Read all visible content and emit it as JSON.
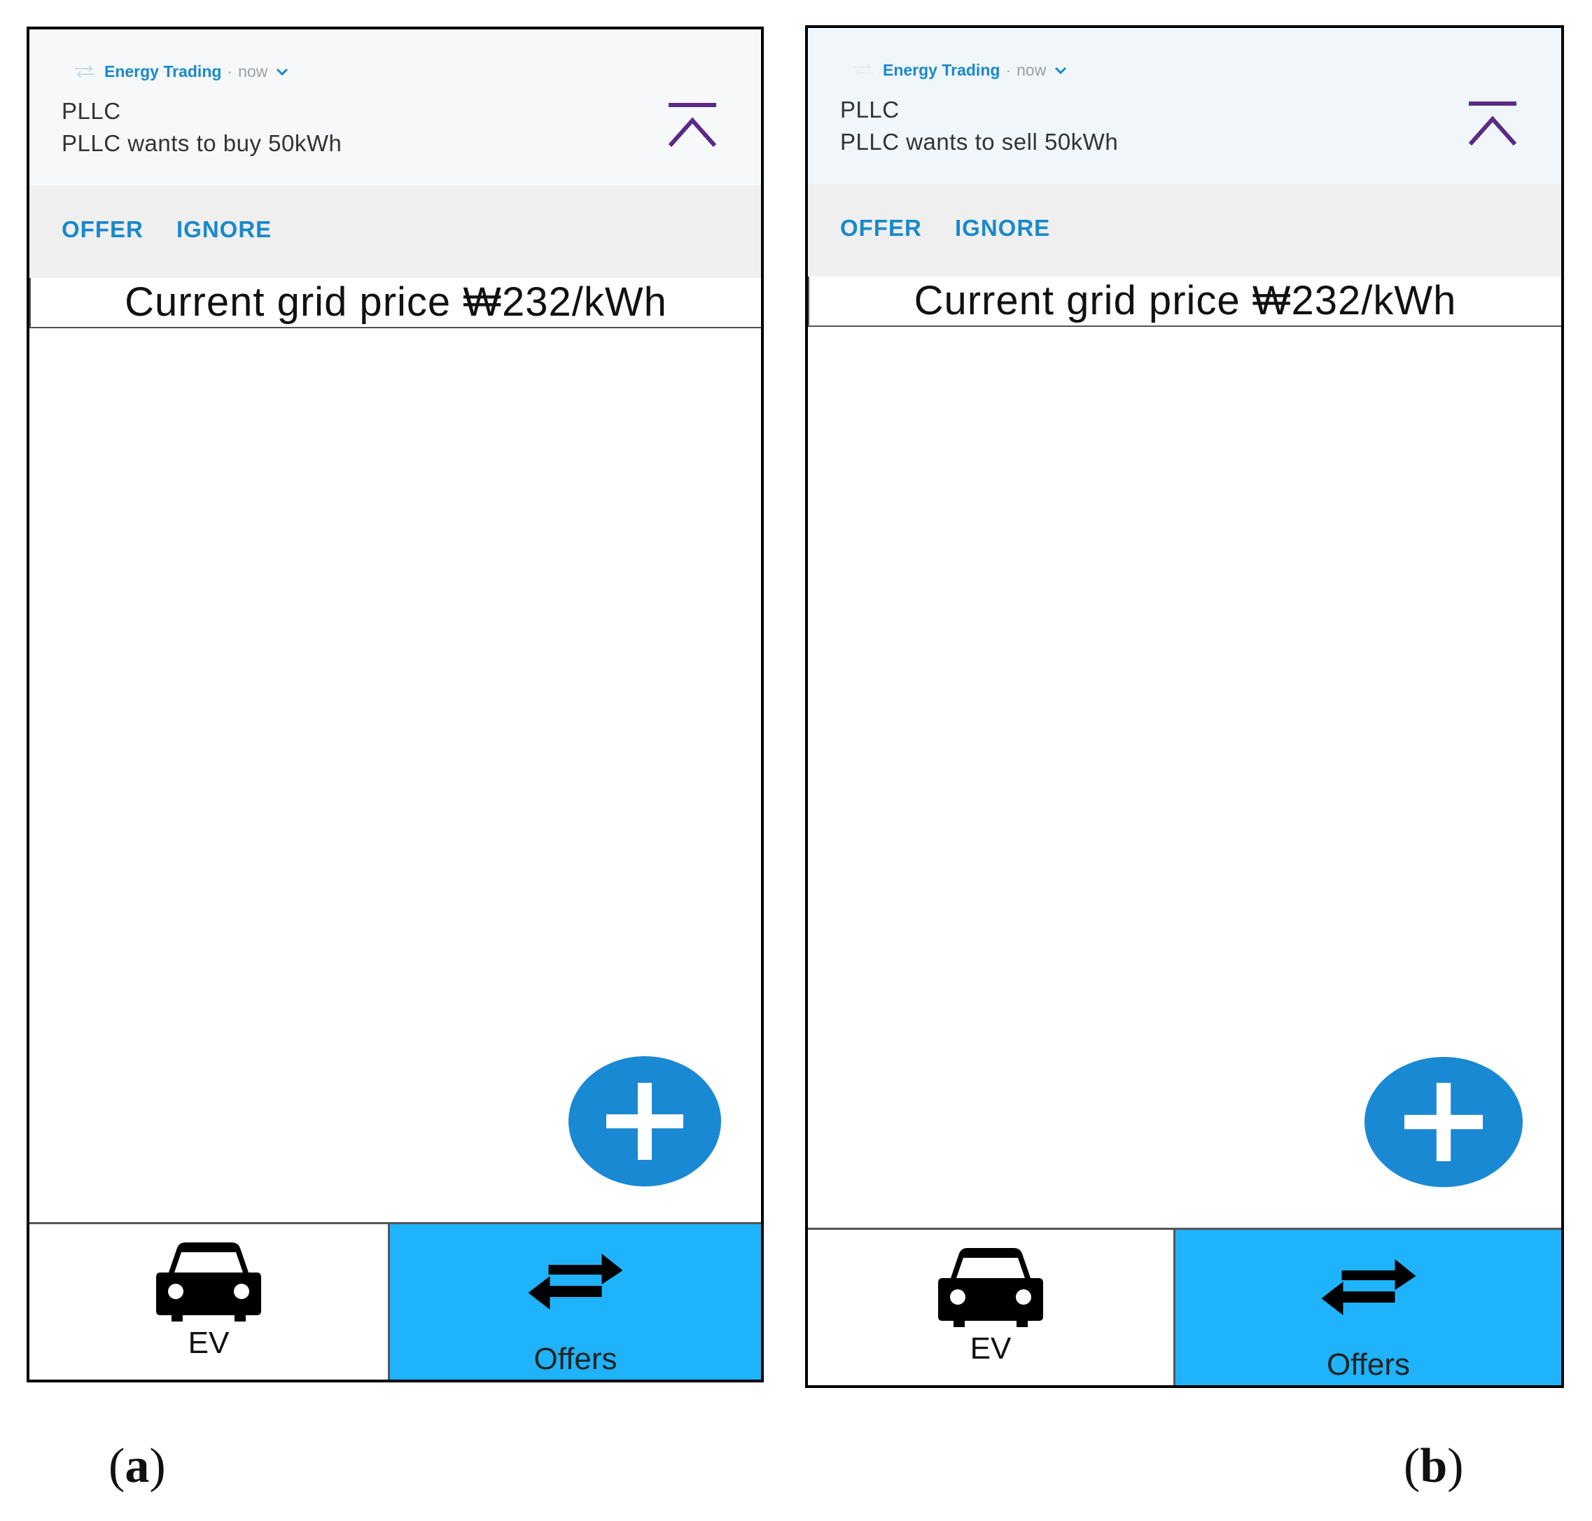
{
  "screens": [
    {
      "notification": {
        "app_name": "Energy Trading",
        "separator": "·",
        "time": "now",
        "title": "PLLC",
        "body": "PLLC wants to buy 50kWh",
        "actions": {
          "offer": "OFFER",
          "ignore": "IGNORE"
        }
      },
      "grid_price": "Current grid price ₩232/kWh",
      "tabs": {
        "ev": "EV",
        "offers": "Offers",
        "active": "offers"
      }
    },
    {
      "notification": {
        "app_name": "Energy Trading",
        "separator": "·",
        "time": "now",
        "title": "PLLC",
        "body": "PLLC wants to sell 50kWh",
        "actions": {
          "offer": "OFFER",
          "ignore": "IGNORE"
        }
      },
      "grid_price": "Current grid price ₩232/kWh",
      "tabs": {
        "ev": "EV",
        "offers": "Offers",
        "active": "offers"
      }
    }
  ],
  "captions": {
    "a": {
      "open": "(",
      "letter": "a",
      "close": ")"
    },
    "b": {
      "open": "(",
      "letter": "b",
      "close": ")"
    }
  },
  "colors": {
    "accent": "#1a89c9",
    "fab": "#1a89d4",
    "active_tab": "#1eb3fb",
    "collapse_icon": "#5b2a86"
  },
  "icons": {
    "app": "swap-arrows-icon",
    "collapse": "collapse-up-icon",
    "fab": "plus-icon",
    "ev_tab": "car-icon",
    "offers_tab": "swap-arrows-icon"
  }
}
